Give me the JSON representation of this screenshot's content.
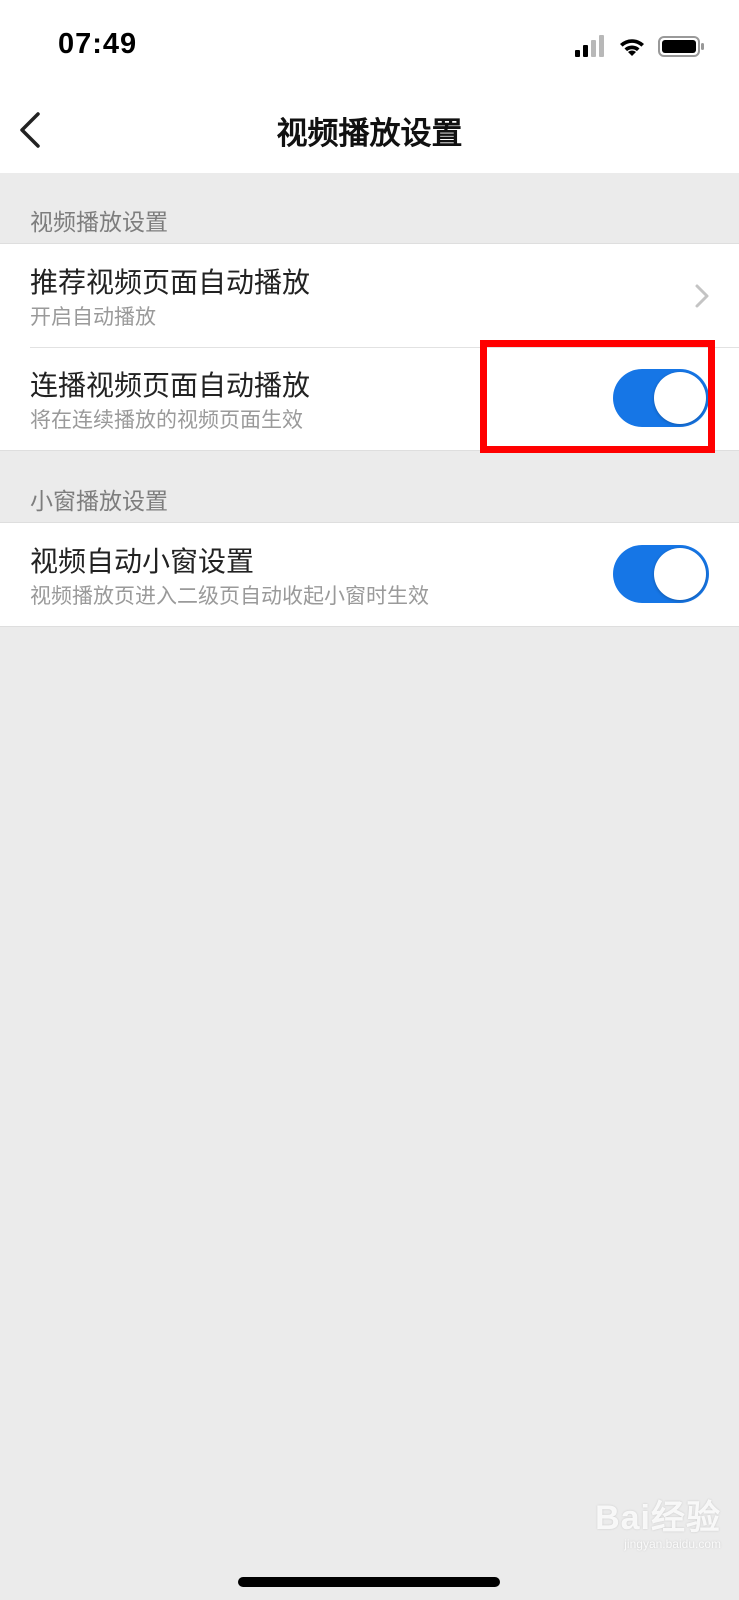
{
  "status_bar": {
    "time": "07:49"
  },
  "nav": {
    "title": "视频播放设置"
  },
  "sections": [
    {
      "header": "视频播放设置",
      "rows": [
        {
          "title": "推荐视频页面自动播放",
          "subtitle": "开启自动播放",
          "control": "chevron-right-icon"
        },
        {
          "title": "连播视频页面自动播放",
          "subtitle": "将在连续播放的视频页面生效",
          "control": "toggle",
          "on": true
        }
      ]
    },
    {
      "header": "小窗播放设置",
      "rows": [
        {
          "title": "视频自动小窗设置",
          "subtitle": "视频播放页进入二级页自动收起小窗时生效",
          "control": "toggle",
          "on": true
        }
      ]
    }
  ],
  "watermark": {
    "brand": "Bai经验",
    "url": "jingyan.baidu.com"
  },
  "colors": {
    "toggle_on": "#1676e6",
    "highlight": "#ff0000",
    "background": "#ebebeb"
  }
}
